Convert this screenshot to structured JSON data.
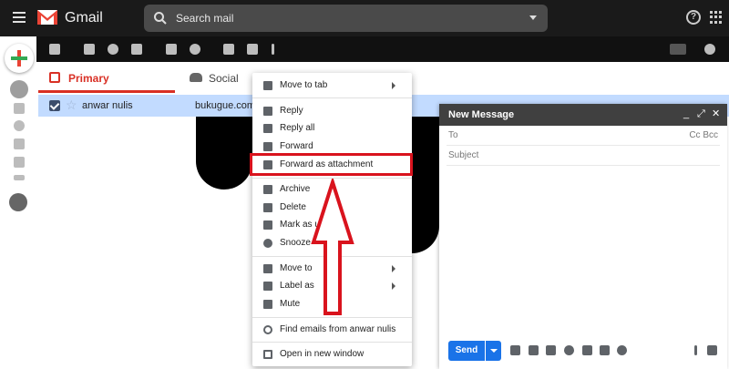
{
  "app": {
    "brand": "Gmail"
  },
  "search": {
    "placeholder": "Search mail"
  },
  "tabs": [
    {
      "label": "Primary",
      "icon": "inbox-icon"
    },
    {
      "label": "Social",
      "icon": "people-icon"
    }
  ],
  "email": {
    "sender": "anwar nulis",
    "subject": "bukugue.com - h"
  },
  "context_menu": {
    "items": [
      {
        "label": "Move to tab",
        "icon": "move-to-tab-icon",
        "submenu": true
      },
      {
        "label": "Reply",
        "icon": "reply-icon"
      },
      {
        "label": "Reply all",
        "icon": "reply-all-icon"
      },
      {
        "label": "Forward",
        "icon": "forward-icon"
      },
      {
        "label": "Forward as attachment",
        "icon": "forward-attachment-icon",
        "highlighted": true
      },
      {
        "label": "Archive",
        "icon": "archive-icon"
      },
      {
        "label": "Delete",
        "icon": "delete-icon"
      },
      {
        "label": "Mark as un",
        "icon": "mark-unread-icon"
      },
      {
        "label": "Snooze",
        "icon": "snooze-icon"
      },
      {
        "label": "Move to",
        "icon": "move-to-icon",
        "submenu": true
      },
      {
        "label": "Label as",
        "icon": "label-icon",
        "submenu": true
      },
      {
        "label": "Mute",
        "icon": "mute-icon"
      },
      {
        "label": "Find emails from anwar nulis",
        "icon": "search-icon"
      },
      {
        "label": "Open in new window",
        "icon": "open-new-window-icon"
      }
    ]
  },
  "compose": {
    "title": "New Message",
    "to_label": "To",
    "cc_bcc": "Cc Bcc",
    "subject_label": "Subject",
    "send_label": "Send"
  },
  "colors": {
    "accent_red": "#d93025",
    "highlight_red": "#d9131d",
    "send_blue": "#1a73e8",
    "row_selected": "#c2dbff"
  }
}
